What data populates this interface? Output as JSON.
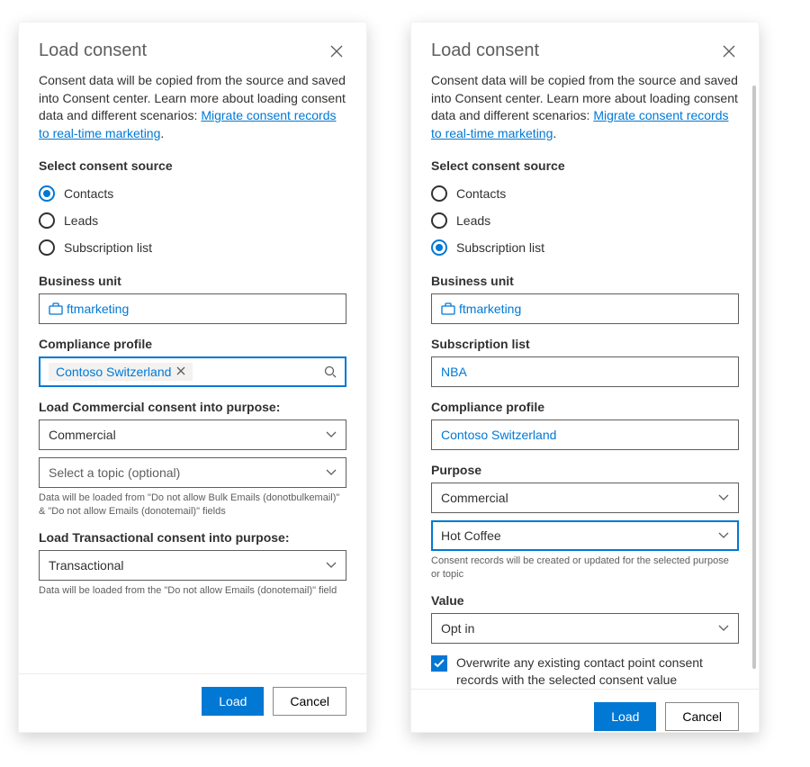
{
  "left": {
    "title": "Load consent",
    "intro_1": "Consent data will be copied from the source and saved into Consent center. Learn more about loading consent data and different scenarios: ",
    "intro_link": "Migrate consent records to real-time marketing",
    "intro_dot": ".",
    "source_label": "Select consent source",
    "radios": {
      "contacts": "Contacts",
      "leads": "Leads",
      "sublist": "Subscription list"
    },
    "selected_source": "contacts",
    "bu_label": "Business unit",
    "bu_value": "ftmarketing",
    "cp_label": "Compliance profile",
    "cp_chip": "Contoso Switzerland",
    "commercial_label": "Load Commercial consent into purpose:",
    "commercial_value": "Commercial",
    "topic_placeholder": "Select a topic (optional)",
    "commercial_help": "Data will be loaded from \"Do not allow Bulk Emails (donotbulkemail)\" & \"Do not allow Emails (donotemail)\" fields",
    "trans_label": "Load Transactional consent into purpose:",
    "trans_value": "Transactional",
    "trans_help": "Data will be loaded from the \"Do not allow Emails (donotemail)\" field",
    "btn_load": "Load",
    "btn_cancel": "Cancel"
  },
  "right": {
    "title": "Load consent",
    "intro_1": "Consent data will be copied from the source and saved into Consent center. Learn more about loading consent data and different scenarios: ",
    "intro_link": "Migrate consent records to real-time marketing",
    "intro_dot": ".",
    "source_label": "Select consent source",
    "radios": {
      "contacts": "Contacts",
      "leads": "Leads",
      "sublist": "Subscription list"
    },
    "selected_source": "sublist",
    "bu_label": "Business unit",
    "bu_value": "ftmarketing",
    "sl_label": "Subscription list",
    "sl_value": "NBA",
    "cp_label": "Compliance profile",
    "cp_value": "Contoso Switzerland",
    "purpose_label": "Purpose",
    "purpose_value": "Commercial",
    "topic_value": "Hot Coffee",
    "purpose_help": "Consent records will be created or updated for the selected purpose or topic",
    "value_label": "Value",
    "value_value": "Opt in",
    "overwrite_label": "Overwrite any existing contact point consent records with the selected consent value",
    "btn_load": "Load",
    "btn_cancel": "Cancel"
  }
}
